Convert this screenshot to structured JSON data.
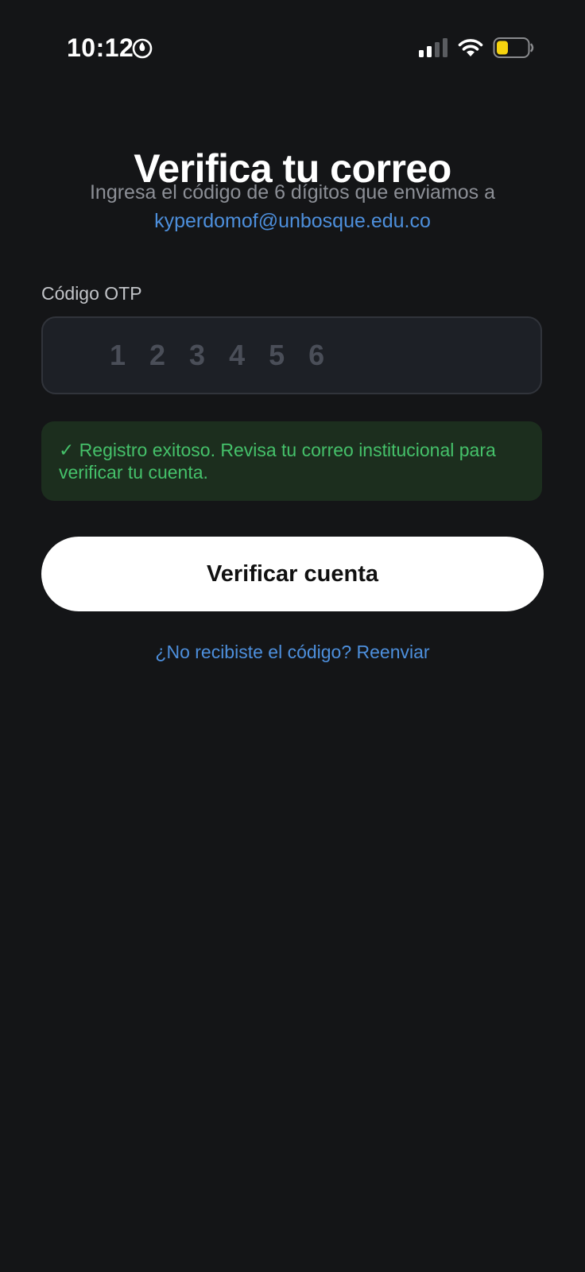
{
  "status_bar": {
    "time": "10:12",
    "icons": [
      "focus-icon",
      "signal-icon",
      "wifi-icon",
      "battery-icon"
    ],
    "battery_color": "#f5d30f"
  },
  "header": {
    "title": "Verifica tu correo",
    "subtitle": "Ingresa el código de 6 dígitos que enviamos a",
    "email": "kyperdomof@unbosque.edu.co"
  },
  "form": {
    "otp_label": "Código OTP",
    "otp_value": "",
    "otp_placeholder": "1 2 3 4 5 6",
    "success_message": "✓ Registro exitoso. Revisa tu correo institucional para verificar tu cuenta.",
    "verify_button_label": "Verificar cuenta",
    "resend_link_label": "¿No recibiste el código? Reenviar"
  },
  "colors": {
    "background": "#141517",
    "accent_link": "#4d8fdc",
    "success_text": "#45c16a",
    "success_bg": "#1c2e1e"
  }
}
